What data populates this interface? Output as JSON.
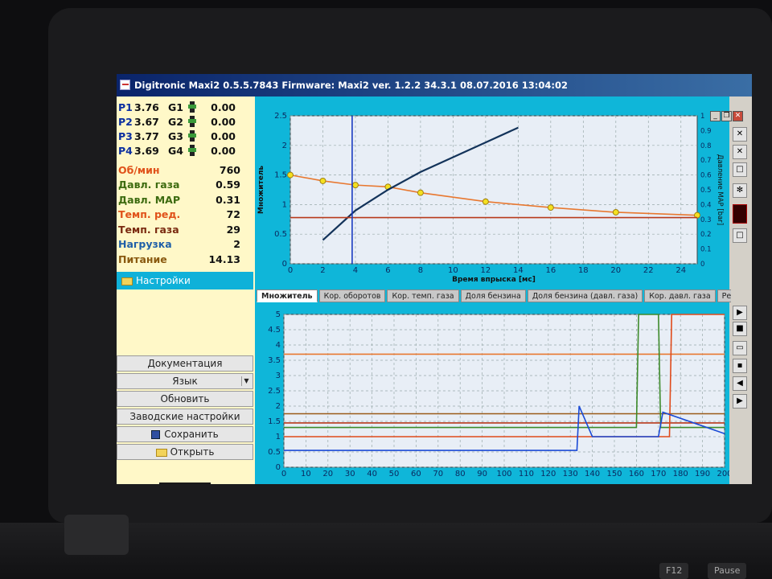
{
  "window": {
    "title": "Digitronic Maxi2 0.5.5.7843 Firmware: Maxi2  ver. 1.2.2  34.3.1   08.07.2016 13:04:02",
    "controls": [
      "_",
      "❐",
      "✕"
    ]
  },
  "sensors": [
    {
      "p": "P1",
      "pv": "3.76",
      "g": "G1",
      "gv": "0.00"
    },
    {
      "p": "P2",
      "pv": "3.67",
      "g": "G2",
      "gv": "0.00"
    },
    {
      "p": "P3",
      "pv": "3.77",
      "g": "G3",
      "gv": "0.00"
    },
    {
      "p": "P4",
      "pv": "3.69",
      "g": "G4",
      "gv": "0.00"
    }
  ],
  "params": [
    {
      "label": "Об/мин",
      "value": "760",
      "color": "#e0521a"
    },
    {
      "label": "Давл. газа",
      "value": "0.59",
      "color": "#3d6b10"
    },
    {
      "label": "Давл. MAP",
      "value": "0.31",
      "color": "#3d6b10"
    },
    {
      "label": "Темп. ред.",
      "value": "72",
      "color": "#e0521a"
    },
    {
      "label": "Темп. газа",
      "value": "29",
      "color": "#7a2a10"
    },
    {
      "label": "Нагрузка",
      "value": "2",
      "color": "#1f5fa8"
    },
    {
      "label": "Питание",
      "value": "14.13",
      "color": "#8a5a10"
    }
  ],
  "settings_label": "Настройки",
  "buttons": {
    "documentation": "Документация",
    "language": "Язык",
    "update": "Обновить",
    "factory": "Заводские настройки",
    "save": "Сохранить",
    "open": "Открыть"
  },
  "tabs": [
    "Множитель",
    "Кор. оборотов",
    "Кор. темп. газа",
    "Доля бензина",
    "Доля бензина (давл. газа)",
    "Кор. давл. газа",
    "Регистратор"
  ],
  "icons": {
    "app": "app-icon",
    "settings": "folder-icon",
    "save": "floppy-icon",
    "open": "folder-icon",
    "toolbar": [
      "close-icon",
      "close-icon",
      "square-icon",
      "snowflake-icon",
      "digit-icon",
      "square-icon",
      "play-icon",
      "stop-icon",
      "folder-icon",
      "floppy-icon",
      "left-icon",
      "right-icon"
    ]
  },
  "colors": {
    "accent": "#0fb6d9",
    "titlebar": "#0a246a",
    "left_panel": "#fff8c8",
    "plot_bg": "#e8eef6"
  },
  "chart_data": [
    {
      "type": "line",
      "xlabel": "Время впрыска [мс]",
      "ylabel": "Множитель",
      "y2label": "Давление MAP [bar]",
      "xlim": [
        0,
        25
      ],
      "ylim": [
        0,
        2.5
      ],
      "y2lim": [
        0,
        1
      ],
      "xticks": [
        "0",
        "2",
        "4",
        "6",
        "8",
        "10",
        "12",
        "14",
        "16",
        "18",
        "20",
        "22",
        "24"
      ],
      "yticks": [
        "0",
        "0.5",
        "1",
        "1.5",
        "2",
        "2.5"
      ],
      "y2ticks": [
        "0",
        "0.1",
        "0.2",
        "0.3",
        "0.4",
        "0.5",
        "0.6",
        "0.7",
        "0.8",
        "0.9",
        "1"
      ],
      "grid": true,
      "series": [
        {
          "kind": "multiplier",
          "color": "#e87830",
          "x": [
            0,
            2,
            4,
            6,
            8,
            12,
            16,
            20,
            25
          ],
          "y": [
            1.5,
            1.4,
            1.33,
            1.3,
            1.2,
            1.05,
            0.95,
            0.87,
            0.82
          ]
        },
        {
          "kind": "fit",
          "color": "#13335a",
          "x": [
            2,
            4,
            6,
            8,
            10,
            12,
            14
          ],
          "y": [
            0.4,
            0.9,
            1.25,
            1.55,
            1.8,
            2.05,
            2.3
          ]
        },
        {
          "kind": "limit",
          "color": "#b83a1c",
          "x": [
            0,
            25
          ],
          "y": [
            0.78,
            0.78
          ]
        },
        {
          "kind": "cursor",
          "color": "#1a3cc0",
          "x": [
            3.8,
            3.8
          ],
          "y": [
            0,
            2.5
          ]
        }
      ]
    },
    {
      "type": "line",
      "xlim": [
        0,
        200
      ],
      "ylim": [
        0,
        5
      ],
      "xticks": [
        "0",
        "10",
        "20",
        "30",
        "40",
        "50",
        "60",
        "70",
        "80",
        "90",
        "100",
        "110",
        "120",
        "130",
        "140",
        "150",
        "160",
        "170",
        "180",
        "190",
        "200"
      ],
      "yticks": [
        "0",
        "0.5",
        "1",
        "1.5",
        "2",
        "2.5",
        "3",
        "3.5",
        "4",
        "4.5",
        "5"
      ],
      "grid": true,
      "series": [
        {
          "color": "#e87830",
          "x": [
            0,
            200
          ],
          "y": [
            3.7,
            3.7
          ]
        },
        {
          "color": "#9a5a18",
          "x": [
            0,
            200
          ],
          "y": [
            1.75,
            1.75
          ]
        },
        {
          "color": "#b83a1c",
          "x": [
            0,
            170,
            200
          ],
          "y": [
            1.45,
            1.45,
            1.45
          ]
        },
        {
          "color": "#3d8a2a",
          "x": [
            0,
            160,
            161,
            170,
            171,
            200
          ],
          "y": [
            1.3,
            1.3,
            5,
            5,
            1.3,
            1.3
          ]
        },
        {
          "color": "#e04a1a",
          "x": [
            0,
            175,
            176,
            200
          ],
          "y": [
            1.0,
            1.0,
            5,
            5
          ]
        },
        {
          "color": "#1a4ad6",
          "x": [
            0,
            133,
            134,
            140,
            170,
            172,
            200
          ],
          "y": [
            0.55,
            0.55,
            2.0,
            1.0,
            1.0,
            1.8,
            1.1
          ]
        }
      ]
    }
  ]
}
